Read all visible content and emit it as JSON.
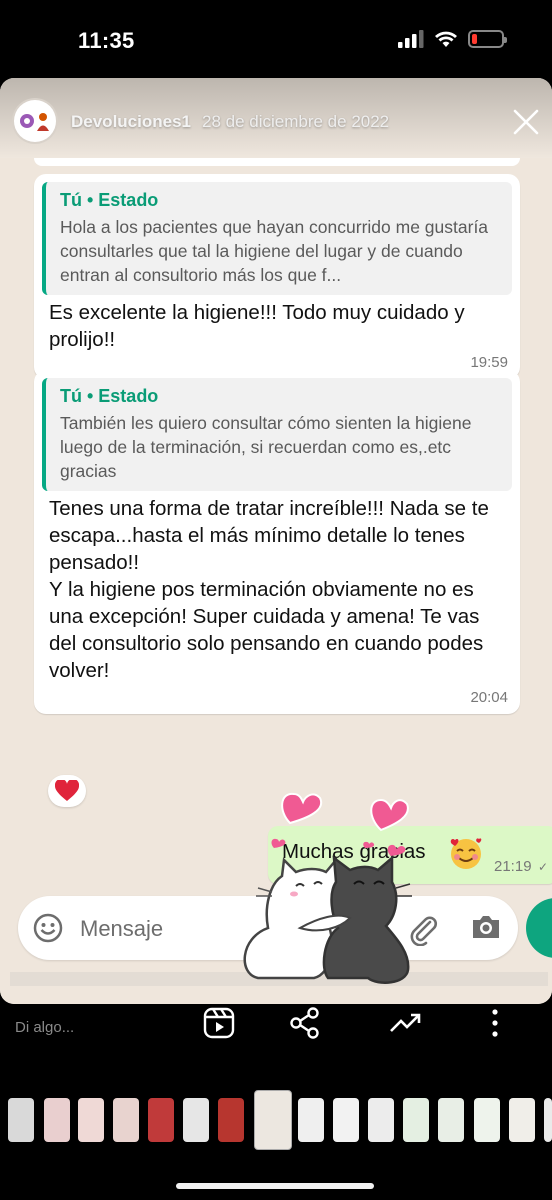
{
  "status_bar": {
    "time": "11:35",
    "battery_level": 0.12,
    "battery_color": "#ff3b30"
  },
  "story": {
    "username": "Devoluciones1",
    "date": "28 de diciembre de 2022",
    "close_icon": "close-icon"
  },
  "chat": {
    "messages": [
      {
        "quote_title": "Tú • Estado",
        "quote_text": "Hola a los pacientes que hayan concurrido me gustaría consultarles que tal la higiene del lugar y de cuando entran al consultorio más los que f...",
        "text": "Es excelente la higiene!!! Todo muy cuidado y prolijo!!",
        "time": "19:59"
      },
      {
        "quote_title": "Tú • Estado",
        "quote_text": "También les quiero consultar cómo sienten la higiene luego de la terminación, si recuerdan como es,.etc gracias",
        "text": "Tenes una forma de tratar increíble!!! Nada se te escapa...hasta el más mínimo detalle lo tenes pensado!!\nY la higiene pos terminación obviamente no es una excepción! Super cuidada y amena! Te vas del consultorio solo pensando en cuando podes volver!",
        "time": "20:04",
        "reaction": "❤️"
      }
    ],
    "outgoing": {
      "text": "Muchas gracias",
      "emoji": "🥰",
      "time": "21:19"
    },
    "input_placeholder": "Mensaje",
    "accent": "#06a884"
  },
  "bottom": {
    "reply_placeholder": "Di algo...",
    "actions": [
      "reels-icon",
      "share-icon",
      "insights-icon",
      "more-icon"
    ]
  }
}
